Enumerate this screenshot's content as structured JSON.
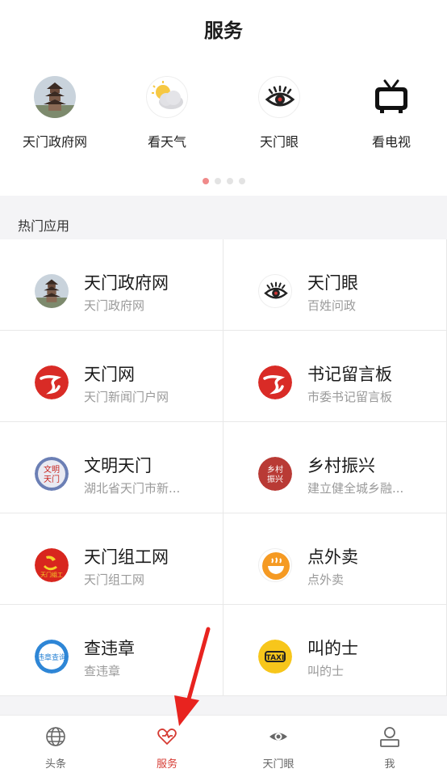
{
  "header": {
    "title": "服务"
  },
  "carousel": {
    "items": [
      {
        "label": "天门政府网",
        "icon": "pagoda-icon"
      },
      {
        "label": "看天气",
        "icon": "weather-icon"
      },
      {
        "label": "天门眼",
        "icon": "eye-icon"
      },
      {
        "label": "看电视",
        "icon": "tv-icon"
      }
    ],
    "pages": 4,
    "active_page": 1
  },
  "hot_apps": {
    "title": "热门应用",
    "items": [
      {
        "name": "天门政府网",
        "sub": "天门政府网",
        "icon": "pagoda-icon"
      },
      {
        "name": "天门眼",
        "sub": "百姓问政",
        "icon": "eye-icon"
      },
      {
        "name": "天门网",
        "sub": "天门新闻门户网",
        "icon": "tianmen-net-icon"
      },
      {
        "name": "书记留言板",
        "sub": "市委书记留言板",
        "icon": "tianmen-net-icon"
      },
      {
        "name": "文明天门",
        "sub": "湖北省天门市新...",
        "icon": "civilization-icon",
        "icon_text": [
          "文明",
          "天门"
        ]
      },
      {
        "name": "乡村振兴",
        "sub": "建立健全城乡融...",
        "icon": "rural-revival-icon",
        "icon_text": [
          "乡村",
          "振兴"
        ]
      },
      {
        "name": "天门组工网",
        "sub": "天门组工网",
        "icon": "party-icon",
        "icon_text": "天门组工"
      },
      {
        "name": "点外卖",
        "sub": "点外卖",
        "icon": "takeout-icon"
      },
      {
        "name": "查违章",
        "sub": "查违章",
        "icon": "violation-icon",
        "icon_text": "违章查询"
      },
      {
        "name": "叫的士",
        "sub": "叫的士",
        "icon": "taxi-icon",
        "icon_text": "TAXI"
      }
    ]
  },
  "tabbar": {
    "items": [
      {
        "label": "头条",
        "icon": "globe-icon"
      },
      {
        "label": "服务",
        "icon": "heart-icon",
        "active": true
      },
      {
        "label": "天门眼",
        "icon": "eye-icon"
      },
      {
        "label": "我",
        "icon": "person-icon"
      }
    ]
  },
  "colors": {
    "accent": "#d63b33",
    "dot_active": "#f08a8a",
    "annotation_arrow": "#e8231f"
  }
}
